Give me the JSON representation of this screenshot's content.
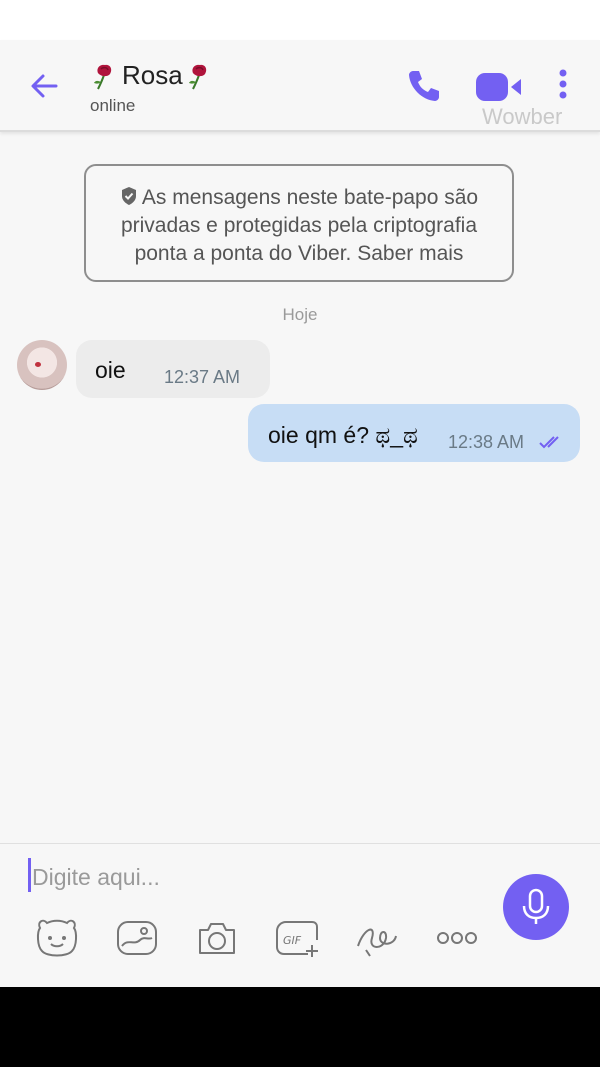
{
  "header": {
    "contact_name": "Rosa",
    "contact_status": "online",
    "watermark": "Wowber"
  },
  "encryption_notice": {
    "text": "As mensagens neste bate-papo são privadas e protegidas pela criptografia ponta a ponta do Viber. Saber mais"
  },
  "day_separator": "Hoje",
  "messages": [
    {
      "direction": "incoming",
      "text": "oie",
      "time": "12:37 AM"
    },
    {
      "direction": "outgoing",
      "text": "oie qm é? ಥ_ಥ",
      "time": "12:38 AM",
      "status": "read"
    }
  ],
  "composer": {
    "placeholder": "Digite aqui...",
    "value": "",
    "tools": [
      "sticker-icon",
      "gallery-icon",
      "camera-icon",
      "gif-icon",
      "doodle-icon",
      "more-options-icon"
    ],
    "gif_label": "GIF",
    "send_action": "microphone-icon"
  },
  "colors": {
    "accent": "#7360f2",
    "outgoing_bubble": "#c7ddf5",
    "incoming_bubble": "#ececec"
  }
}
